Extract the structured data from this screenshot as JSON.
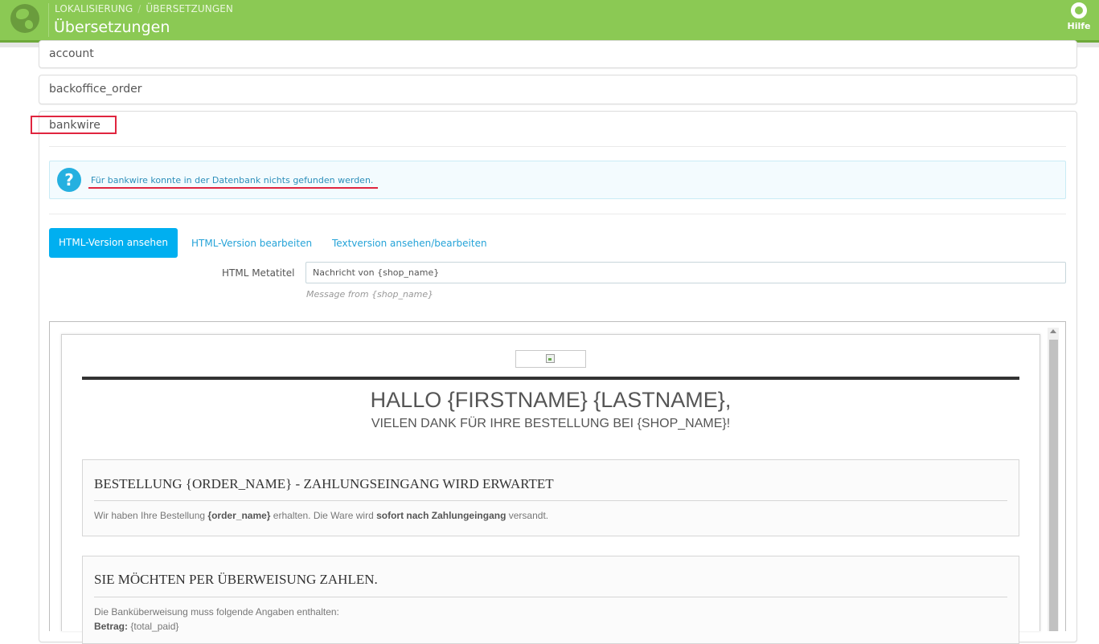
{
  "header": {
    "breadcrumb": [
      "LOKALISIERUNG",
      "ÜBERSETZUNGEN"
    ],
    "breadcrumb_separator": "/",
    "title": "Übersetzungen",
    "help_label": "Hilfe",
    "icons": {
      "logo": "globe-icon",
      "help": "lifebuoy-icon"
    },
    "colors": {
      "bar": "#8bc954"
    }
  },
  "sections": [
    {
      "label": "account"
    },
    {
      "label": "backoffice_order"
    },
    {
      "label": "bankwire"
    }
  ],
  "alert": {
    "icon": "question-icon",
    "text": "Für bankwire konnte in der Datenbank nichts gefunden werden."
  },
  "tabs": [
    {
      "label": "HTML-Version ansehen",
      "active": true
    },
    {
      "label": "HTML-Version bearbeiten",
      "active": false
    },
    {
      "label": "Textversion ansehen/bearbeiten",
      "active": false
    }
  ],
  "meta": {
    "label": "HTML Metatitel",
    "value": "Nachricht von {shop_name}",
    "hint": "Message from {shop_name}"
  },
  "preview": {
    "greeting": "HALLO {FIRSTNAME} {LASTNAME},",
    "thanks": "VIELEN DANK FÜR IHRE BESTELLUNG BEI {SHOP_NAME}!",
    "order_box": {
      "heading": "BESTELLUNG {ORDER_NAME} - ZAHLUNGSEINGANG WIRD ERWARTET",
      "text_1": "Wir haben Ihre Bestellung ",
      "text_bold_1": "{order_name}",
      "text_2": " erhalten. Die Ware wird ",
      "text_bold_2": "sofort nach Zahlungeingang",
      "text_3": " versandt."
    },
    "transfer_box": {
      "heading": "SIE MÖCHTEN PER ÜBERWEISUNG ZAHLEN.",
      "intro": "Die Banküberweisung muss folgende Angaben enthalten:",
      "amount_label": "Betrag:",
      "amount_value": " {total_paid}"
    }
  }
}
